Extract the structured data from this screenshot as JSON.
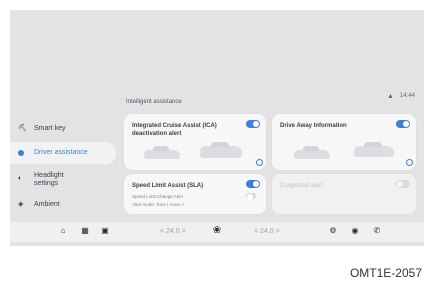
{
  "status": {
    "time": "14:44",
    "icon": "signal-icon"
  },
  "section_title": "Intelligent assistance",
  "sidebar": {
    "items": [
      {
        "label": "Smart key",
        "icon": "key-icon",
        "active": false
      },
      {
        "label": "Driver assistance",
        "icon": "dot-icon",
        "active": true
      },
      {
        "label": "Headlight settings",
        "icon": "headlight-icon",
        "active": false
      },
      {
        "label": "Ambient",
        "icon": "ambient-icon",
        "active": false
      }
    ]
  },
  "cards": [
    {
      "title": "Integrated Cruise Assist (ICA)\ndeactivation alert",
      "toggle": "on"
    },
    {
      "title": "Drive Away Information",
      "toggle": "on"
    },
    {
      "title": "Speed Limit Assist (SLA)",
      "toggle": "on",
      "sub1": "Speed Limit Change Alert",
      "sub2": "Alert mode: Tone | Voice >"
    },
    {
      "title": "Congested alert",
      "toggle": "off"
    }
  ],
  "bottombar": {
    "left_temp": "< 24.0 >",
    "right_temp": "< 24.0 >",
    "icons": [
      "home-icon",
      "apps-icon",
      "car-icon",
      "fan-icon",
      "settings-icon",
      "media-icon",
      "phone-icon"
    ]
  },
  "caption": "OMT1E-2057"
}
